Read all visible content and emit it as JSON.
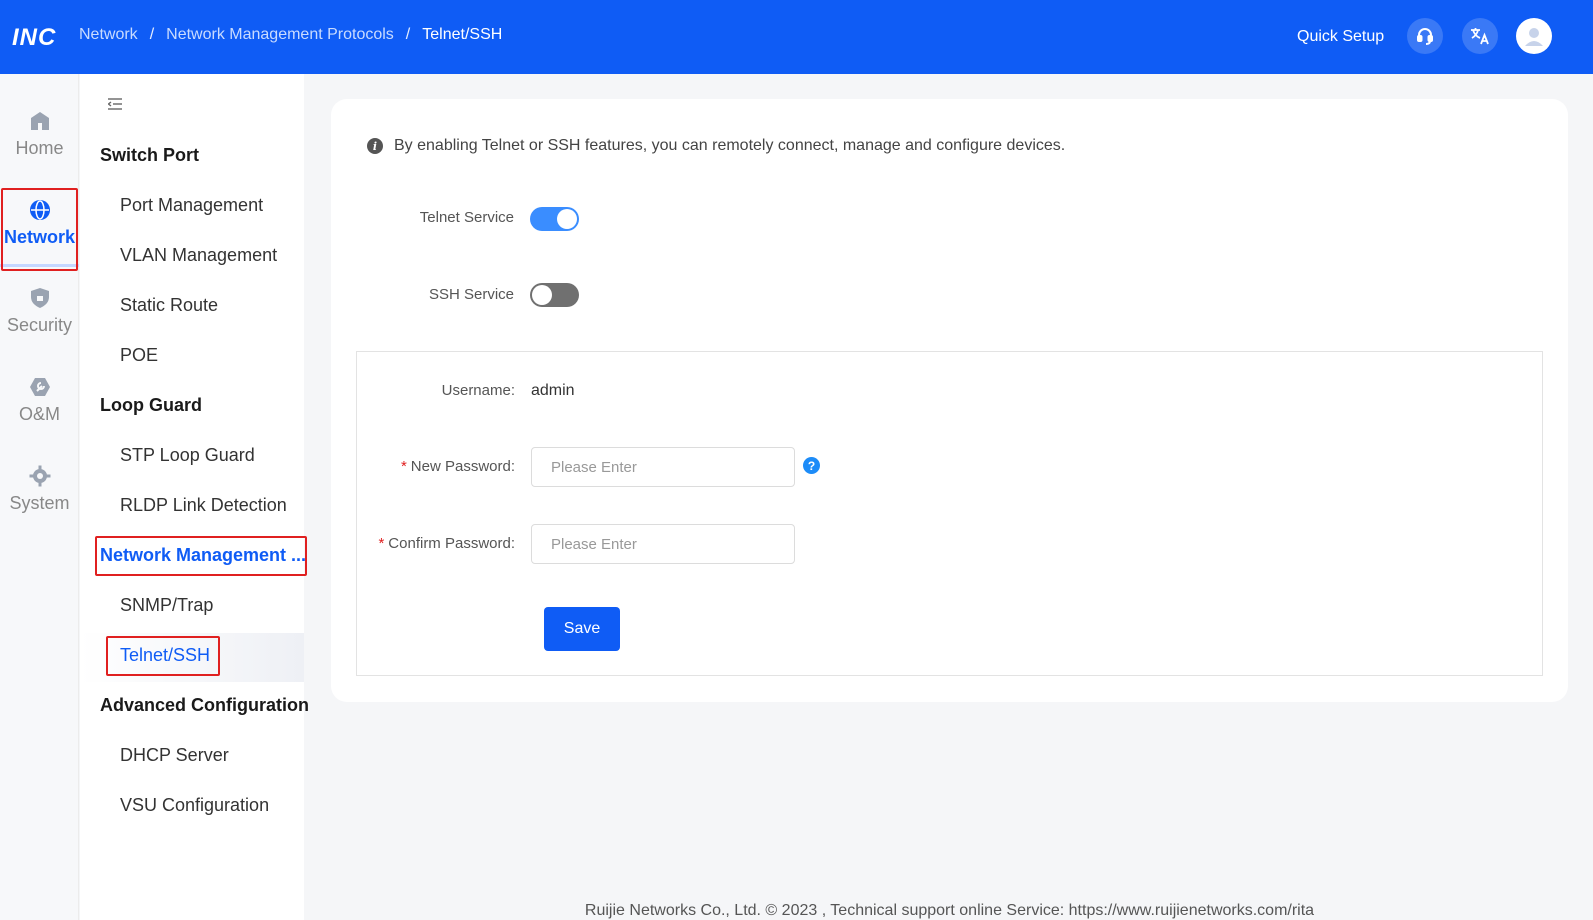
{
  "header": {
    "logo": "INC",
    "breadcrumb": [
      {
        "label": "Network"
      },
      {
        "label": "Network Management Protocols"
      },
      {
        "label": "Telnet/SSH"
      }
    ],
    "breadcrumb_separator": "/",
    "quick_setup": "Quick Setup",
    "icons": [
      "headset-icon",
      "translate-icon",
      "user-avatar-icon"
    ]
  },
  "rail": {
    "items": [
      {
        "label": "Home",
        "icon": "home-icon"
      },
      {
        "label": "Network",
        "icon": "globe-icon",
        "active": true
      },
      {
        "label": "Security",
        "icon": "shield-icon"
      },
      {
        "label": "O&M",
        "icon": "wrench-icon"
      },
      {
        "label": "System",
        "icon": "gear-icon"
      }
    ]
  },
  "submenu": {
    "groups": {
      "switch_port": "Switch Port",
      "loop_guard": "Loop Guard",
      "network_mgmt": "Network Management ...",
      "advanced": "Advanced Configuration"
    },
    "items": {
      "port_management": "Port Management",
      "vlan_management": "VLAN Management",
      "static_route": "Static Route",
      "poe": "POE",
      "stp_loop_guard": "STP Loop Guard",
      "rldp": "RLDP Link Detection",
      "snmp": "SNMP/Trap",
      "telnet_ssh": "Telnet/SSH",
      "dhcp_server": "DHCP Server",
      "vsu": "VSU Configuration"
    }
  },
  "main": {
    "info": "By enabling Telnet or SSH features, you can remotely connect, manage and configure devices.",
    "telnet": {
      "label": "Telnet Service",
      "enabled": true
    },
    "ssh": {
      "label": "SSH Service",
      "enabled": false
    },
    "username": {
      "label": "Username:",
      "value": "admin"
    },
    "new_password": {
      "required_mark": "*",
      "label": "New Password:",
      "placeholder": "Please Enter",
      "value": ""
    },
    "confirm_password": {
      "required_mark": "*",
      "label": "Confirm Password:",
      "placeholder": "Please Enter",
      "value": ""
    },
    "save_label": "Save"
  },
  "footer": {
    "text": "Ruijie Networks Co., Ltd. © 2023 ,  Technical support online Service: https://www.ruijienetworks.com/rita"
  },
  "colors": {
    "brand": "#0f5cf5",
    "toggle_on": "#3a8dff",
    "toggle_off": "#707070",
    "highlight": "#e02020"
  }
}
